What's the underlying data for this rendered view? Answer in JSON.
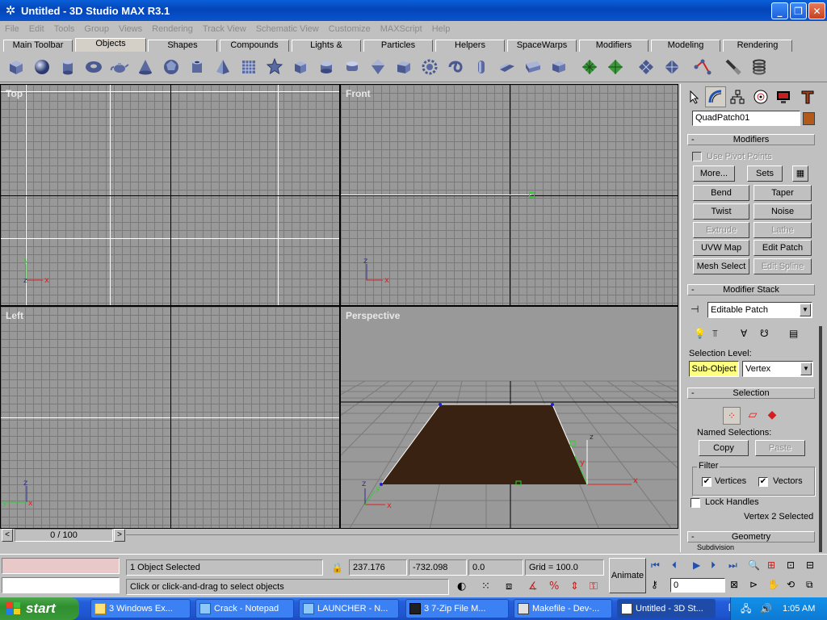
{
  "window": {
    "title": "Untitled - 3D Studio MAX R3.1"
  },
  "menu": [
    "File",
    "Edit",
    "Tools",
    "Group",
    "Views",
    "Rendering",
    "Track View",
    "Schematic View",
    "Customize",
    "MAXScript",
    "Help"
  ],
  "tabs": [
    "Main Toolbar",
    "Objects",
    "Shapes",
    "Compounds",
    "Lights & Cameras",
    "Particles",
    "Helpers",
    "SpaceWarps",
    "Modifiers",
    "Modeling",
    "Rendering"
  ],
  "toolbar_icons": [
    "box-icon",
    "sphere-icon",
    "cylinder-icon",
    "torus-icon",
    "teapot-icon",
    "cone-icon",
    "geosphere-icon",
    "tube-icon",
    "pyramid-icon",
    "grid-plane-icon",
    "star-icon",
    "chamfer-box-icon",
    "oiltank-icon",
    "capsule-icon",
    "gengon-icon",
    "prism-icon",
    "gear-icon",
    "torus-knot-icon",
    "spindle-icon",
    "wedge-icon",
    "hedra-icon",
    "ringwave-icon",
    "quadpatch-icon",
    "tripatch-icon",
    "nurbs-cv-icon",
    "nurbs-point-icon",
    "bezier-icon",
    "brush-icon",
    "spring-icon"
  ],
  "viewports": {
    "top": "Top",
    "front": "Front",
    "left": "Left",
    "perspective": "Perspective"
  },
  "axes": {
    "x": "x",
    "y": "y",
    "z": "z"
  },
  "command_panel": {
    "object_name": "QuadPatch01",
    "object_color": "#b35a1a",
    "modifiers_title": "Modifiers",
    "use_pivot_points": "Use Pivot Points",
    "more": "More...",
    "sets": "Sets",
    "buttons": [
      "Bend",
      "Taper",
      "Twist",
      "Noise",
      "Extrude",
      "Lathe",
      "UVW Map",
      "Edit Patch",
      "Mesh Select",
      "Edit Spline"
    ],
    "modifier_stack_title": "Modifier Stack",
    "stack_value": "Editable Patch",
    "selection_level_label": "Selection Level:",
    "sub_object": "Sub-Object",
    "sub_object_level": "Vertex",
    "selection_title": "Selection",
    "named_selections": "Named Selections:",
    "copy": "Copy",
    "paste": "Paste",
    "filter": "Filter",
    "vertices": "Vertices",
    "vectors": "Vectors",
    "lock_handles": "Lock Handles",
    "selected_info": "Vertex 2 Selected",
    "geometry_title": "Geometry",
    "subdivision": "Subdivision"
  },
  "timeline": {
    "frame": "0 / 100"
  },
  "status": {
    "objects_selected": "1 Object Selected",
    "x": "237.176",
    "y": "-732.098",
    "z": "0.0",
    "grid": "Grid = 100.0",
    "prompt": "Click or click-and-drag to select objects",
    "animate": "Animate",
    "frame_field": "0"
  },
  "taskbar": {
    "start": "start",
    "tasks": [
      "3 Windows Ex...",
      "Crack - Notepad",
      "LAUNCHER - N...",
      "3 7-Zip File M...",
      "Makefile - Dev-...",
      "Untitled - 3D St..."
    ],
    "clock": "1:05 AM"
  },
  "colors": {
    "patch": "#3a2212",
    "accent_blue": "#0a54cf",
    "sub_object_yellow": "#ffff80"
  }
}
